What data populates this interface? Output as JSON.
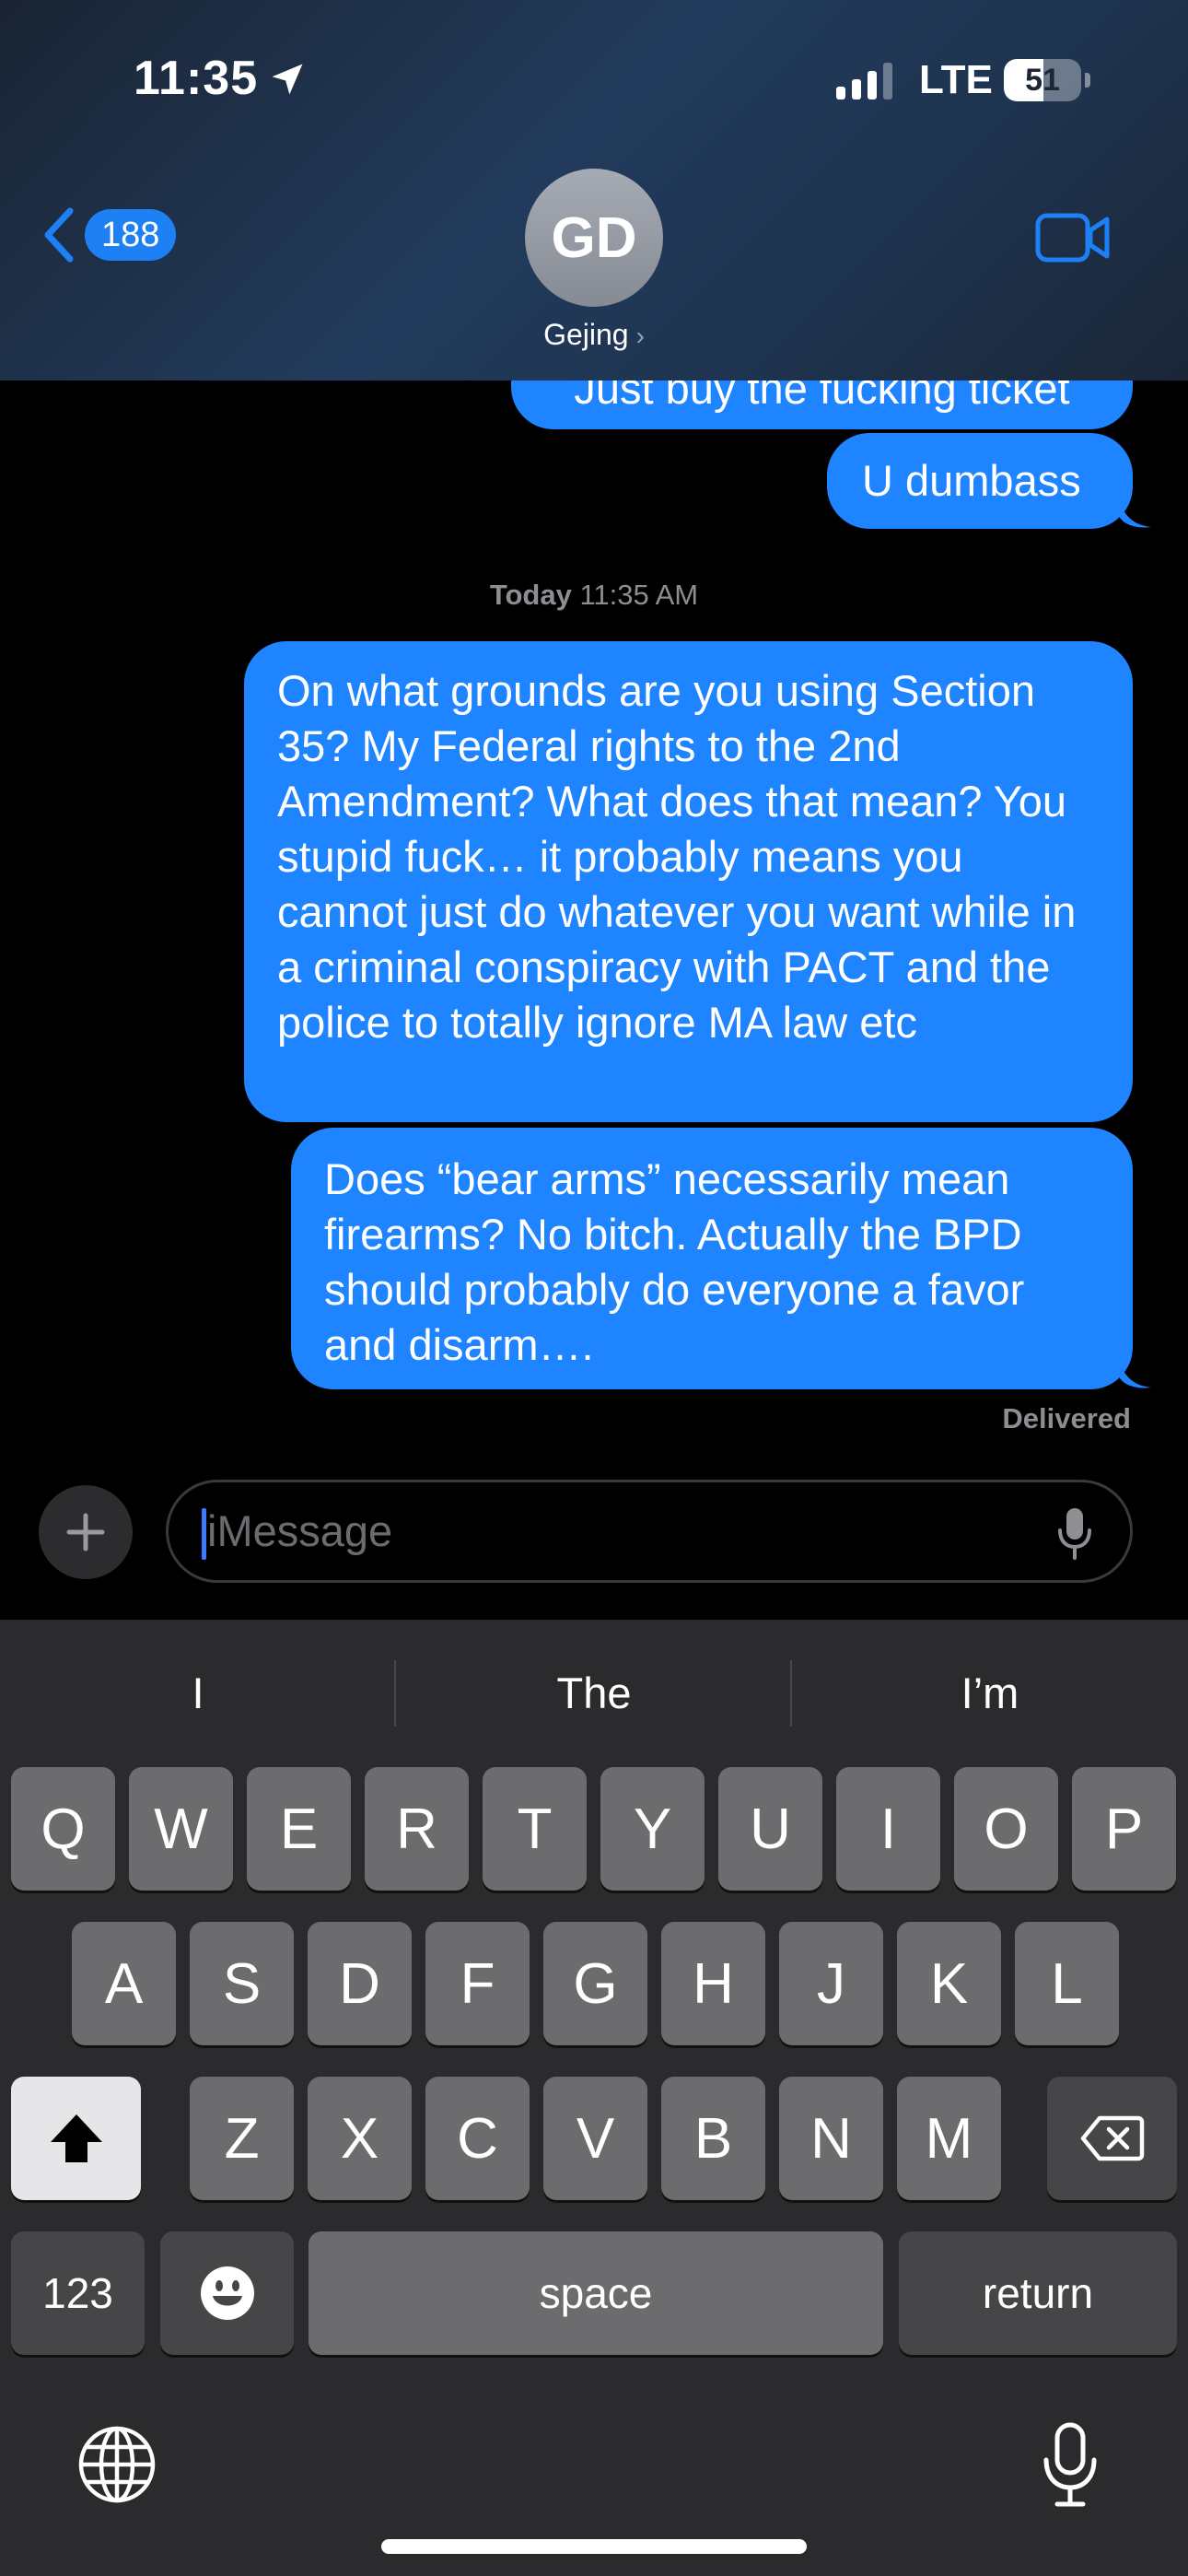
{
  "status_bar": {
    "time": "11:35",
    "network": "LTE",
    "battery_level": "51",
    "battery_fraction": 0.51
  },
  "header": {
    "back_count": "188",
    "avatar_initials": "GD",
    "contact_name": "Gejing",
    "contact_chevron": "›"
  },
  "messages": {
    "partial": "Just buy the fucking ticket",
    "dumbass": "U dumbass",
    "timestamp_day": "Today",
    "timestamp_time": " 11:35 AM",
    "grounds": "On what grounds are you using Section 35? My Federal rights to the 2nd Amendment? What does that mean? You stupid fuck… it probably means you cannot just do whatever you want while in a criminal conspiracy with PACT and the police to totally ignore MA law etc",
    "arms": "Does “bear arms” necessarily mean firearms? No bitch. Actually the BPD should probably do everyone a favor and disarm….",
    "delivered": "Delivered"
  },
  "input": {
    "placeholder": "iMessage"
  },
  "keyboard": {
    "suggestions": [
      "I",
      "The",
      "I’m"
    ],
    "row1": [
      "Q",
      "W",
      "E",
      "R",
      "T",
      "Y",
      "U",
      "I",
      "O",
      "P"
    ],
    "row2": [
      "A",
      "S",
      "D",
      "F",
      "G",
      "H",
      "J",
      "K",
      "L"
    ],
    "row3": [
      "Z",
      "X",
      "C",
      "V",
      "B",
      "N",
      "M"
    ],
    "numbers_label": "123",
    "space_label": "space",
    "return_label": "return"
  },
  "colors": {
    "bubble_blue": "#1e84ff",
    "accent_blue": "#1e80f5",
    "keyboard_bg": "#2b2b2d"
  }
}
